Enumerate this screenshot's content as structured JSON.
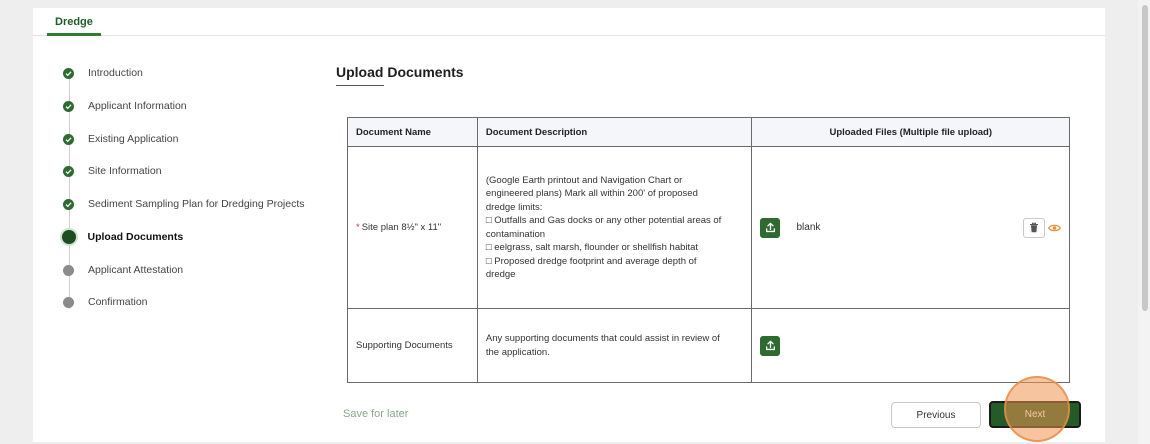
{
  "tab": {
    "label": "Dredge"
  },
  "steps": [
    {
      "label": "Introduction",
      "status": "done"
    },
    {
      "label": "Applicant Information",
      "status": "done"
    },
    {
      "label": "Existing Application",
      "status": "done"
    },
    {
      "label": "Site Information",
      "status": "done"
    },
    {
      "label": "Sediment Sampling Plan for Dredging Projects",
      "status": "done"
    },
    {
      "label": "Upload Documents",
      "status": "active"
    },
    {
      "label": "Applicant Attestation",
      "status": "pending"
    },
    {
      "label": "Confirmation",
      "status": "pending"
    }
  ],
  "section": {
    "title": "Upload Documents"
  },
  "table": {
    "headers": {
      "name": "Document Name",
      "description": "Document Description",
      "files": "Uploaded Files (Multiple file upload)"
    },
    "rows": [
      {
        "required_mark": "*",
        "name": "Site plan 8½\" x 11\"",
        "description_lines": [
          "(Google Earth printout and Navigation Chart or",
          "engineered plans) Mark all within 200' of proposed",
          "dredge limits:",
          "□ Outfalls and Gas docks or any other potential areas of",
          "contamination",
          "□ eelgrass, salt marsh, flounder or shellfish habitat",
          "□ Proposed dredge footprint and average depth of",
          "dredge"
        ],
        "file_name": "blank"
      },
      {
        "name": "Supporting Documents",
        "description_lines": [
          "Any supporting documents that could assist in review of",
          "the application."
        ]
      }
    ]
  },
  "footer": {
    "save_label": "Save for later",
    "previous_label": "Previous",
    "next_label": "Next"
  },
  "colors": {
    "brand_green": "#2e6b30",
    "dark_green": "#255b29",
    "required_red": "#c23934",
    "eye_orange": "#e8913a",
    "click_halo": "#ee9650"
  },
  "icons": {
    "complete": "check-icon",
    "upload": "upload-icon",
    "delete": "trash-icon",
    "preview": "eye-icon"
  }
}
